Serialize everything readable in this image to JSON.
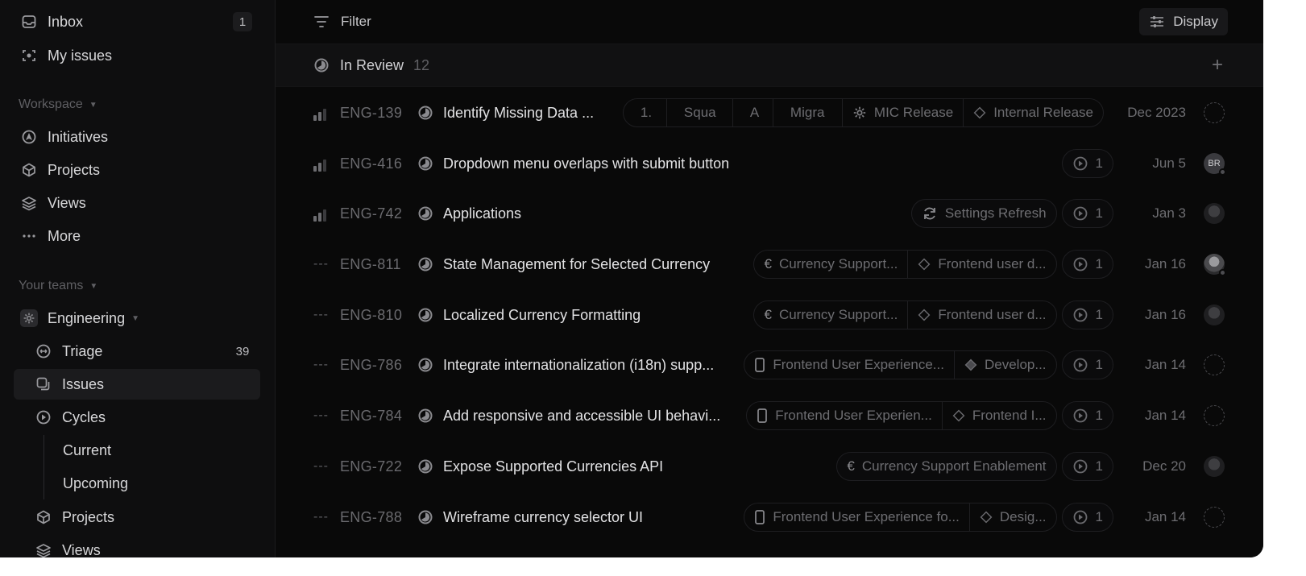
{
  "sidebar": {
    "inbox": {
      "label": "Inbox",
      "count": "1"
    },
    "my_issues": {
      "label": "My issues"
    },
    "workspace_label": "Workspace",
    "workspace_items": [
      {
        "label": "Initiatives",
        "icon": "initiatives-icon"
      },
      {
        "label": "Projects",
        "icon": "projects-icon"
      },
      {
        "label": "Views",
        "icon": "views-icon"
      },
      {
        "label": "More",
        "icon": "more-icon"
      }
    ],
    "teams_label": "Your teams",
    "team": {
      "label": "Engineering"
    },
    "team_items": [
      {
        "label": "Triage",
        "count": "39"
      },
      {
        "label": "Issues"
      },
      {
        "label": "Cycles"
      },
      {
        "label": "Current"
      },
      {
        "label": "Upcoming"
      },
      {
        "label": "Projects"
      },
      {
        "label": "Views"
      }
    ]
  },
  "toolbar": {
    "filter_label": "Filter",
    "display_label": "Display"
  },
  "group": {
    "title": "In Review",
    "count": "12"
  },
  "issues": [
    {
      "id": "ENG-139",
      "title": "Identify Missing Data ...",
      "chips": [
        "1.",
        "Squa",
        "A",
        "Migra"
      ],
      "cycle": "MIC Release",
      "milestone": "Internal Release",
      "date": "Dec 2023"
    },
    {
      "id": "ENG-416",
      "title": "Dropdown menu overlaps with submit button",
      "cycle_count": "1",
      "date": "Jun 5",
      "assignee": "BR"
    },
    {
      "id": "ENG-742",
      "title": "Applications",
      "project": "Settings Refresh",
      "cycle_count": "1",
      "date": "Jan 3"
    },
    {
      "id": "ENG-811",
      "title": "State Management for Selected Currency",
      "project": "Currency Support...",
      "milestone": "Frontend user d...",
      "cycle_count": "1",
      "date": "Jan 16"
    },
    {
      "id": "ENG-810",
      "title": "Localized Currency Formatting",
      "project": "Currency Support...",
      "milestone": "Frontend user d...",
      "cycle_count": "1",
      "date": "Jan 16"
    },
    {
      "id": "ENG-786",
      "title": "Integrate internationalization (i18n) supp...",
      "project": "Frontend User Experience...",
      "milestone": "Develop...",
      "cycle_count": "1",
      "date": "Jan 14"
    },
    {
      "id": "ENG-784",
      "title": "Add responsive and accessible UI behavi...",
      "project": "Frontend User Experien...",
      "milestone": "Frontend I...",
      "cycle_count": "1",
      "date": "Jan 14"
    },
    {
      "id": "ENG-722",
      "title": "Expose Supported Currencies API",
      "project": "Currency Support Enablement",
      "cycle_count": "1",
      "date": "Dec 20"
    },
    {
      "id": "ENG-788",
      "title": "Wireframe currency selector UI",
      "project": "Frontend User Experience fo...",
      "milestone": "Desig...",
      "cycle_count": "1",
      "date": "Jan 14"
    }
  ]
}
